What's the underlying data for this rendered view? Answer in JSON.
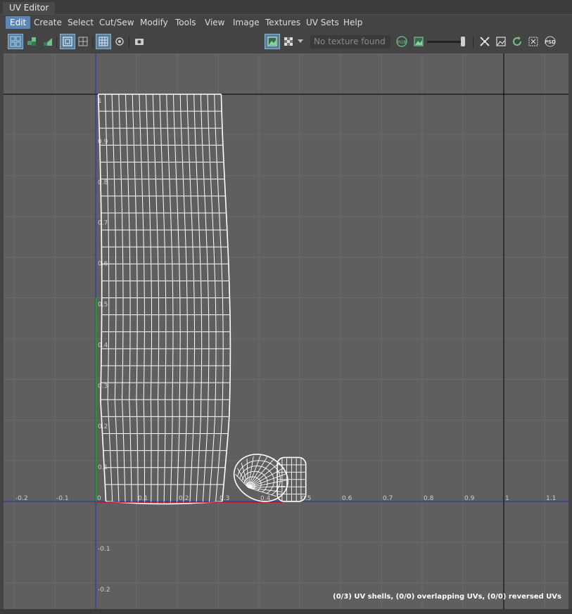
{
  "window": {
    "title": "UV Editor"
  },
  "menu": [
    {
      "label": "Edit",
      "active": true
    },
    {
      "label": "Create"
    },
    {
      "label": "Select"
    },
    {
      "label": "Cut/Sew"
    },
    {
      "label": "Modify"
    },
    {
      "label": "Tools"
    },
    {
      "label": "View"
    },
    {
      "label": "Image"
    },
    {
      "label": "Textures"
    },
    {
      "label": "UV Sets"
    },
    {
      "label": "Help"
    }
  ],
  "toolbar": {
    "texture_field": "No texture found",
    "icons": [
      "uv-shell-select-icon",
      "uv-component-select-icon",
      "uv-face-select-icon",
      "wireframe-toggle-icon",
      "grid-snap-icon",
      "grid-display-icon",
      "isolate-toggle-icon",
      "snapshot-icon",
      "image-display-icon",
      "checker-icon",
      "checker-dropdown-icon",
      "rgb-channel-icon",
      "alpha-channel-icon",
      "exposure-slider",
      "filter-icon",
      "image-range-icon",
      "reload-icon",
      "dim-image-icon",
      "psd-icon"
    ]
  },
  "viewport": {
    "u_labels": [
      "-0.2",
      "-0.1",
      "0",
      "0.1",
      "0.2",
      "0.3",
      "0.4",
      "0.5",
      "0.6",
      "0.7",
      "0.8",
      "0.9",
      "1",
      "1.1"
    ],
    "v_labels": [
      "1",
      "0.9",
      "0.8",
      "0.7",
      "0.6",
      "0.5",
      "0.4",
      "0.3",
      "0.2",
      "0.1",
      "-0.1",
      "-0.2"
    ],
    "colors": {
      "background": "#5f5f5f",
      "grid": "#6b6b6b",
      "u_axis": "#1f2fa8",
      "boundary": "#000000",
      "uv_wire": "#ffffff",
      "u_zero_edge": "#c41f1f",
      "v_zero_edge": "#1fa03a"
    }
  },
  "status": {
    "text": "(0/3) UV shells, (0/0) overlapping UVs, (0/0) reversed UVs"
  }
}
